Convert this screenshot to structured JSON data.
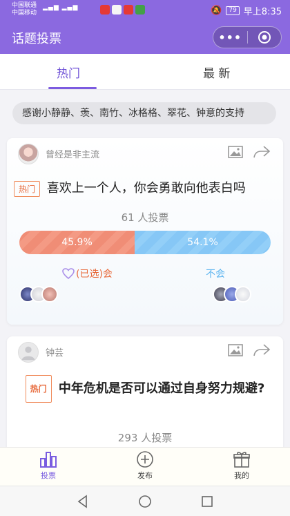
{
  "status_bar": {
    "carrier_1": "中国联通",
    "carrier_2": "中国移动",
    "battery": "79",
    "time": "早上8:35"
  },
  "header": {
    "title": "话题投票",
    "menu_icon": "more-dots-icon",
    "close_icon": "target-circle-icon"
  },
  "tabs": [
    {
      "label": "热门",
      "active": true
    },
    {
      "label": "最 新",
      "active": false
    }
  ],
  "thanks_banner": "感谢小静静、羡、南竹、冰格格、翠花、钟意的支持",
  "cards": [
    {
      "author": "曾经是非主流",
      "badge": "热门",
      "question": "喜欢上一个人，你会勇敢向他表白吗",
      "votes": "61 人投票",
      "option_left_percent": 45.9,
      "option_left_label": "45.9%",
      "option_right_label": "54.1%",
      "option_left_text": "(已选)会",
      "option_right_text": "不会"
    },
    {
      "author": "钟芸",
      "badge": "热门",
      "question": "中年危机是否可以通过自身努力规避?",
      "votes": "293 人投票"
    }
  ],
  "bottom_nav": [
    {
      "label": "投票",
      "active": true
    },
    {
      "label": "发布"
    },
    {
      "label": "我的"
    }
  ],
  "colors": {
    "primary": "#8b69e0",
    "hot": "#e7693a",
    "blue": "#5fb5f0"
  }
}
